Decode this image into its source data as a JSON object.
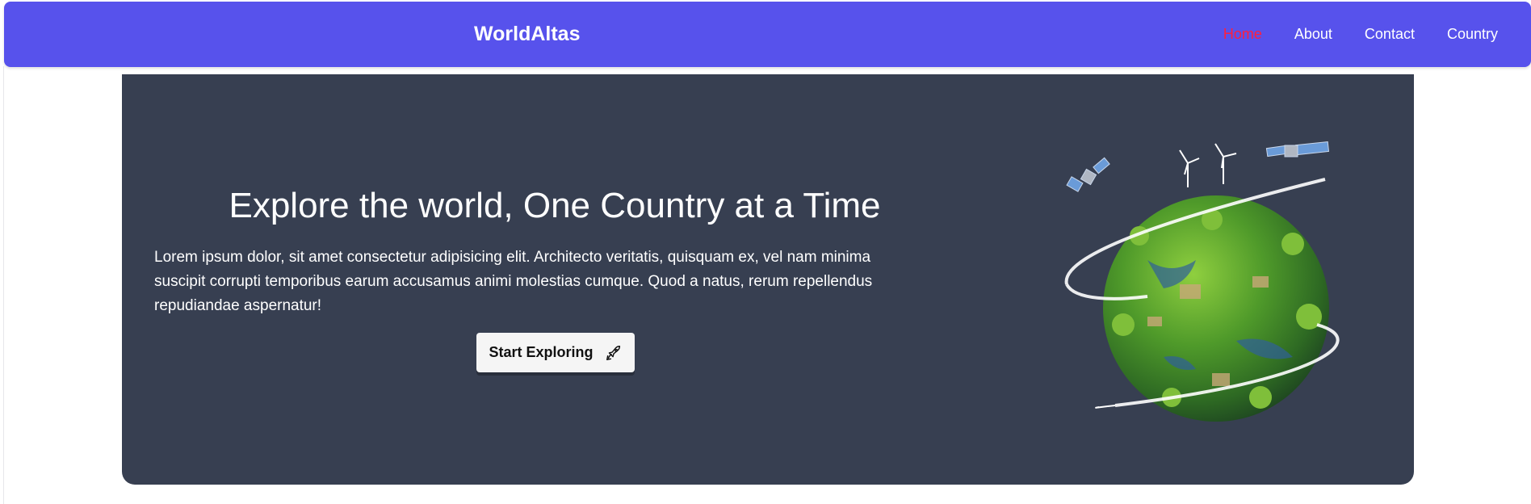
{
  "navbar": {
    "brand": "WorldAltas",
    "links": [
      {
        "label": "Home",
        "active": true
      },
      {
        "label": "About",
        "active": false
      },
      {
        "label": "Contact",
        "active": false
      },
      {
        "label": "Country",
        "active": false
      }
    ]
  },
  "hero": {
    "title": "Explore the world, One Country at a Time",
    "description": "Lorem ipsum dolor, sit amet consectetur adipisicing elit. Architecto veritatis, quisquam ex, vel nam minima suscipit corrupti temporibus earum accusamus animi molestias cumque. Quod a natus, rerum repellendus repudiandae aspernatur!",
    "cta_label": "Start Exploring",
    "cta_icon": "rocket-icon",
    "image": "green-globe-illustration"
  },
  "colors": {
    "navbar_bg": "#5752ec",
    "active_link": "#ff1f3d",
    "hero_bg": "#373f51"
  }
}
